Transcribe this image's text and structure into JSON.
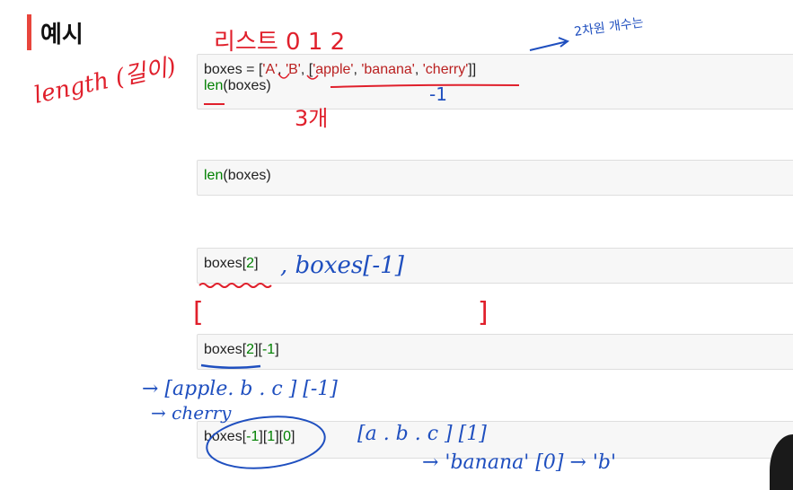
{
  "heading": {
    "text": "예시"
  },
  "cells": [
    {
      "id": "cell-1",
      "lines": [
        [
          {
            "t": "boxes",
            "k": "op"
          },
          {
            "t": " = [",
            "k": "op"
          },
          {
            "t": "'A'",
            "k": "str"
          },
          {
            "t": ", ",
            "k": "op"
          },
          {
            "t": "'B'",
            "k": "str"
          },
          {
            "t": ", [",
            "k": "op"
          },
          {
            "t": "'apple'",
            "k": "str"
          },
          {
            "t": ", ",
            "k": "op"
          },
          {
            "t": "'banana'",
            "k": "str"
          },
          {
            "t": ", ",
            "k": "op"
          },
          {
            "t": "'cherry'",
            "k": "str"
          },
          {
            "t": "]]",
            "k": "op"
          }
        ],
        [
          {
            "t": "len",
            "k": "fn"
          },
          {
            "t": "(boxes)",
            "k": "op"
          }
        ]
      ]
    },
    {
      "id": "cell-2",
      "lines": [
        [
          {
            "t": "len",
            "k": "fn"
          },
          {
            "t": "(boxes)",
            "k": "op"
          }
        ]
      ]
    },
    {
      "id": "cell-3",
      "lines": [
        [
          {
            "t": "boxes",
            "k": "op"
          },
          {
            "t": "[",
            "k": "op"
          },
          {
            "t": "2",
            "k": "num"
          },
          {
            "t": "]",
            "k": "op"
          }
        ]
      ]
    },
    {
      "id": "cell-4",
      "lines": [
        [
          {
            "t": "boxes",
            "k": "op"
          },
          {
            "t": "[",
            "k": "op"
          },
          {
            "t": "2",
            "k": "num"
          },
          {
            "t": "][",
            "k": "op"
          },
          {
            "t": "-1",
            "k": "num"
          },
          {
            "t": "]",
            "k": "op"
          }
        ]
      ]
    },
    {
      "id": "cell-5",
      "lines": [
        [
          {
            "t": "boxes",
            "k": "op"
          },
          {
            "t": "[",
            "k": "op"
          },
          {
            "t": "-1",
            "k": "num"
          },
          {
            "t": "][",
            "k": "op"
          },
          {
            "t": "1",
            "k": "num"
          },
          {
            "t": "][",
            "k": "op"
          },
          {
            "t": "0",
            "k": "num"
          },
          {
            "t": "]",
            "k": "op"
          }
        ]
      ]
    }
  ],
  "annotations": {
    "length": "length (길이)",
    "list_labels": "리스트 0  1    2",
    "second_dim": "2차원 개수는",
    "count": "3개",
    "index_minus_one": "-1",
    "alt_index": ", boxes[-1]",
    "list_bracket": "[                                ]",
    "expansion": "→ [apple. b . c ] [-1]",
    "result": "→ cherry",
    "abc_index": "[a . b . c ] [1]",
    "banana_result": "→ 'banana' [0] → 'b'"
  },
  "colors": {
    "accent": "#e8453c",
    "ink_red": "#e0202c",
    "ink_blue": "#1f4fbf",
    "green": "#008000",
    "string_red": "#ba2121"
  }
}
